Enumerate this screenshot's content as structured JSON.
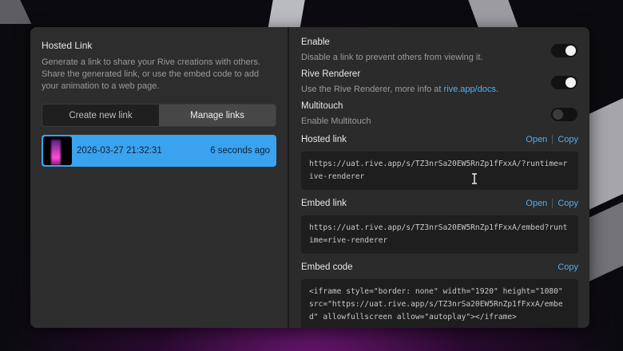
{
  "left": {
    "title": "Hosted Link",
    "description": "Generate a link to share your Rive creations with others. Share the generated link, or use the embed code to add your animation to a web page.",
    "tabs": [
      "Create new link",
      "Manage links"
    ],
    "active_tab": "Manage links",
    "links": [
      {
        "date": "2026-03-27 21:32:31",
        "age": "6 seconds ago"
      }
    ]
  },
  "right": {
    "enable": {
      "label": "Enable",
      "desc": "Disable a link to prevent others from viewing it.",
      "on": true
    },
    "renderer": {
      "label": "Rive Renderer",
      "desc_prefix": "Use the Rive Renderer, more info at ",
      "desc_link": "rive.app/docs",
      "desc_suffix": ".",
      "on": true
    },
    "multitouch": {
      "label": "Multitouch",
      "desc": "Enable Multitouch",
      "on": false
    },
    "hosted": {
      "label": "Hosted link",
      "open": "Open",
      "copy": "Copy",
      "value": "https://uat.rive.app/s/TZ3nrSa20EW5RnZp1fFxxA/?runtime=rive-renderer"
    },
    "embed_link": {
      "label": "Embed link",
      "open": "Open",
      "copy": "Copy",
      "value": "https://uat.rive.app/s/TZ3nrSa20EW5RnZp1fFxxA/embed?runtime=rive-renderer"
    },
    "embed_code": {
      "label": "Embed code",
      "copy": "Copy",
      "value": "<iframe style=\"border: none\" width=\"1920\" height=\"1080\" src=\"https://uat.rive.app/s/TZ3nrSa20EW5RnZp1fFxxA/embed\" allowfullscreen allow=\"autoplay\"></iframe>"
    }
  },
  "colors": {
    "accent": "#3aa3f0",
    "link": "#4eb0f5",
    "panel": "#2d2d2d"
  }
}
